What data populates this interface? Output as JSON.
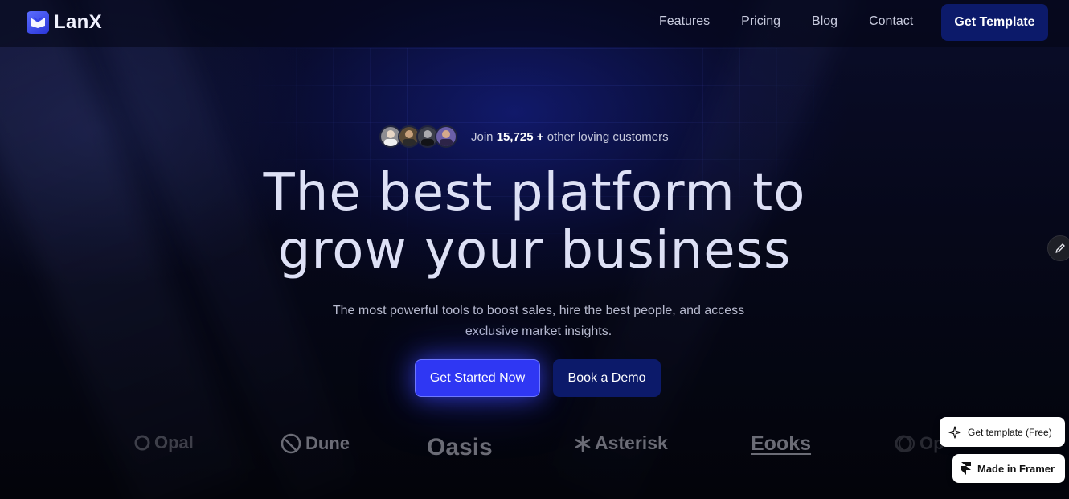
{
  "brand": {
    "name": "LanX",
    "logo_icon": "lanx-logo-icon",
    "accent": "#2f37f3"
  },
  "nav": {
    "links": [
      "Features",
      "Pricing",
      "Blog",
      "Contact"
    ],
    "cta": "Get Template"
  },
  "hero": {
    "social_prefix": "Join",
    "social_count": "15,725 +",
    "social_suffix": "other loving customers",
    "headline_line1": "The best platform to",
    "headline_line2": "grow your business",
    "subtitle_line1": "The most powerful tools to boost sales, hire the best people, and access",
    "subtitle_line2": "exclusive market insights.",
    "primary_cta": "Get Started Now",
    "secondary_cta": "Book a Demo"
  },
  "logos": [
    "Opal",
    "Dune",
    "Oasis",
    "Asterisk",
    "Eooks",
    "Op"
  ],
  "badges": {
    "template": "Get template (Free)",
    "framer": "Made in Framer"
  },
  "colors": {
    "background": "#05060f",
    "nav_button": "#0c1a6a",
    "primary_button": "#2f37f3"
  }
}
